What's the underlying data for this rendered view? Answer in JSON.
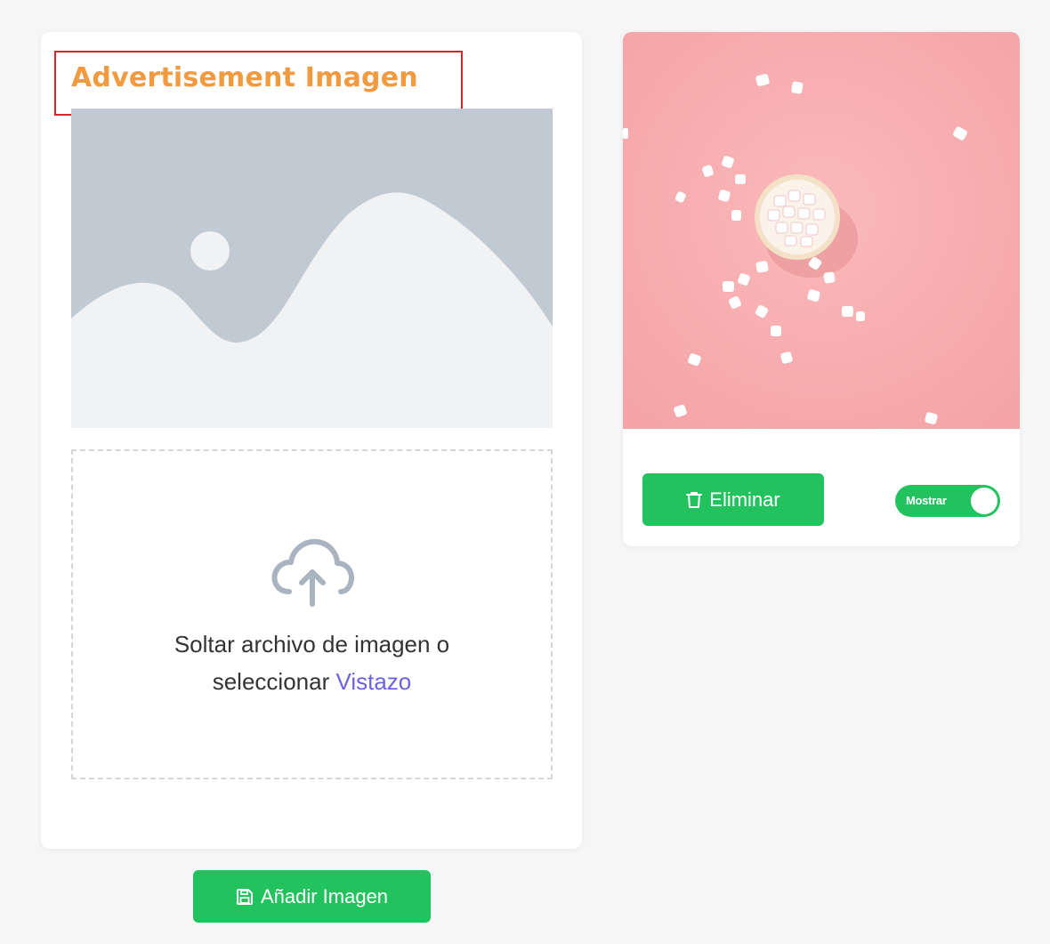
{
  "upload_card": {
    "title": "Advertisement Imagen",
    "dropzone": {
      "text_line1": "Soltar archivo de imagen o",
      "text_line2_prefix": "seleccionar",
      "browse_link": "Vistazo"
    }
  },
  "add_button": {
    "icon": "save-icon",
    "label": "Añadir Imagen"
  },
  "preview_card": {
    "image": "marshmallows-in-bowl-photo",
    "delete_button": {
      "icon": "trash-icon",
      "label": "Eliminar"
    },
    "visibility_toggle": {
      "label": "Mostrar",
      "on": true
    }
  },
  "colors": {
    "accent_green": "#22c35e",
    "title_orange": "#f29a3f",
    "highlight_red": "#d9222a",
    "link_purple": "#6c63e0",
    "photo_pink": "#f9b0b2",
    "placeholder_gray": "#c1c9d2"
  }
}
